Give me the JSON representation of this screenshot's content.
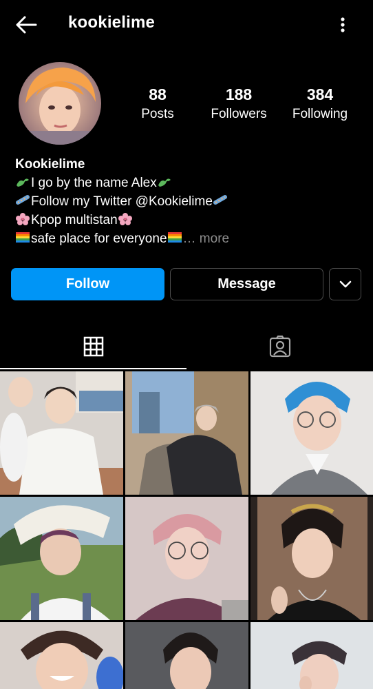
{
  "header": {
    "username": "kookielime"
  },
  "profile": {
    "stats": [
      {
        "value": "88",
        "label": "Posts"
      },
      {
        "value": "188",
        "label": "Followers"
      },
      {
        "value": "384",
        "label": "Following"
      }
    ],
    "display_name": "Kookielime",
    "bio_lines": [
      {
        "emoji": "dinosaur-emoji",
        "text": "I go by the name Alex",
        "emoji_end": "dinosaur-emoji"
      },
      {
        "emoji": "candy-emoji",
        "text": "Follow my Twitter @Kookielime",
        "emoji_end": "candy-emoji"
      },
      {
        "emoji": "cherry-blossom-emoji",
        "text": "Kpop multistan",
        "emoji_end": "cherry-blossom-emoji"
      },
      {
        "emoji": "rainbow-flag-emoji",
        "text": "safe place for everyone",
        "emoji_end": "rainbow-flag-emoji"
      }
    ],
    "more_label": "… more"
  },
  "actions": {
    "follow_label": "Follow",
    "message_label": "Message",
    "follow_color": "#0095f6"
  },
  "tabs": [
    {
      "icon": "grid-icon",
      "active": true
    },
    {
      "icon": "tagged-person-icon",
      "active": false
    }
  ],
  "posts": [
    {
      "description": "photo post 1"
    },
    {
      "description": "photo post 2"
    },
    {
      "description": "photo post 3"
    },
    {
      "description": "photo post 4"
    },
    {
      "description": "photo post 5"
    },
    {
      "description": "photo post 6"
    },
    {
      "description": "photo post 7"
    },
    {
      "description": "photo post 8"
    },
    {
      "description": "photo post 9"
    }
  ]
}
